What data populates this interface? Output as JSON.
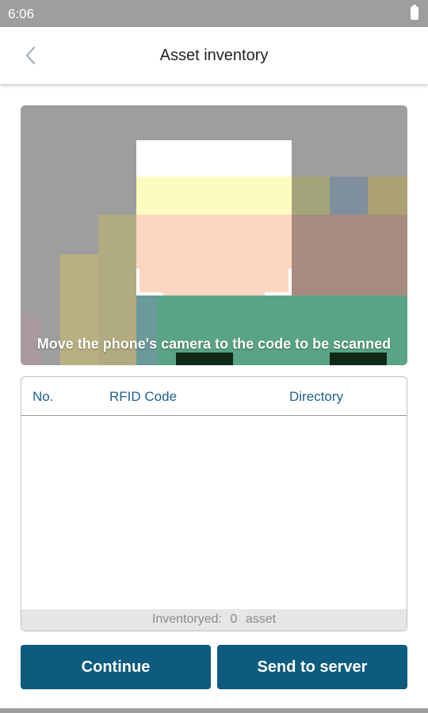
{
  "status_bar": {
    "time": "6:06",
    "battery_icon": "battery-full-icon"
  },
  "app_bar": {
    "title": "Asset inventory",
    "back_icon": "chevron-left-icon"
  },
  "scanner": {
    "hint": "Move the phone's camera to the code to be scanned"
  },
  "table": {
    "columns": [
      "No.",
      "RFID Code",
      "Directory"
    ],
    "rows": [],
    "footer": {
      "label": "Inventoryed:",
      "count": "0",
      "unit": "asset"
    }
  },
  "actions": {
    "continue_label": "Continue",
    "send_label": "Send to server"
  },
  "colors": {
    "primary": "#0d5b7e",
    "header_text": "#20608e",
    "status_bar": "#9e9e9e"
  }
}
